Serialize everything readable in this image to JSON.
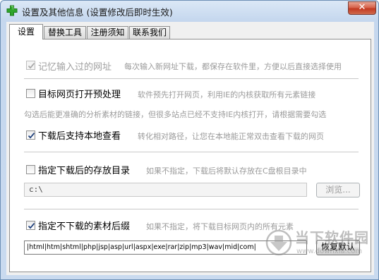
{
  "window": {
    "title": "设置及其他信息 (设置修改后即时生效)",
    "close_label": "✕"
  },
  "tabs": [
    {
      "label": "设置"
    },
    {
      "label": "替换工具"
    },
    {
      "label": "注册须知"
    },
    {
      "label": "联系我们"
    }
  ],
  "settings": {
    "remember_url": {
      "label": "记忆输入过的网址",
      "hint": "每次输入新网址下载，都保存在软件里，方便以后直接选择使用",
      "checked": true,
      "enabled": false
    },
    "preprocess": {
      "label": "目标网页打开预处理",
      "hint": "软件预先打开网页，利用IE的内核获取所有元素链接",
      "hint2": "勾选后能更准确的分析素材的链接，但很多站点已经不支持IE内核打开，请根据需要勾选",
      "checked": false
    },
    "local_view": {
      "label": "下载后支持本地查看",
      "hint": "转化相对路径，让您在本地能正常双击查看下载的网页",
      "checked": true
    },
    "save_dir": {
      "label": "指定下载后的存放目录",
      "hint": "如果不指定，下载后将默认存放在C盘根目录中",
      "checked": false,
      "path_value": "c:\\",
      "browse_label": "浏览..."
    },
    "exclude_ext": {
      "label": "指定不下载的素材后缀",
      "hint": "如果不指定，将下载目标网页内的所有元素",
      "checked": true,
      "ext_value": "|html|htm|shtml|php|jsp|asp|url|aspx|exe|rar|zip|mp3|wav|mid|com|",
      "restore_label": "恢复默认"
    }
  },
  "watermark": {
    "brand": "当下软件园",
    "url": "www.downxia.com"
  }
}
